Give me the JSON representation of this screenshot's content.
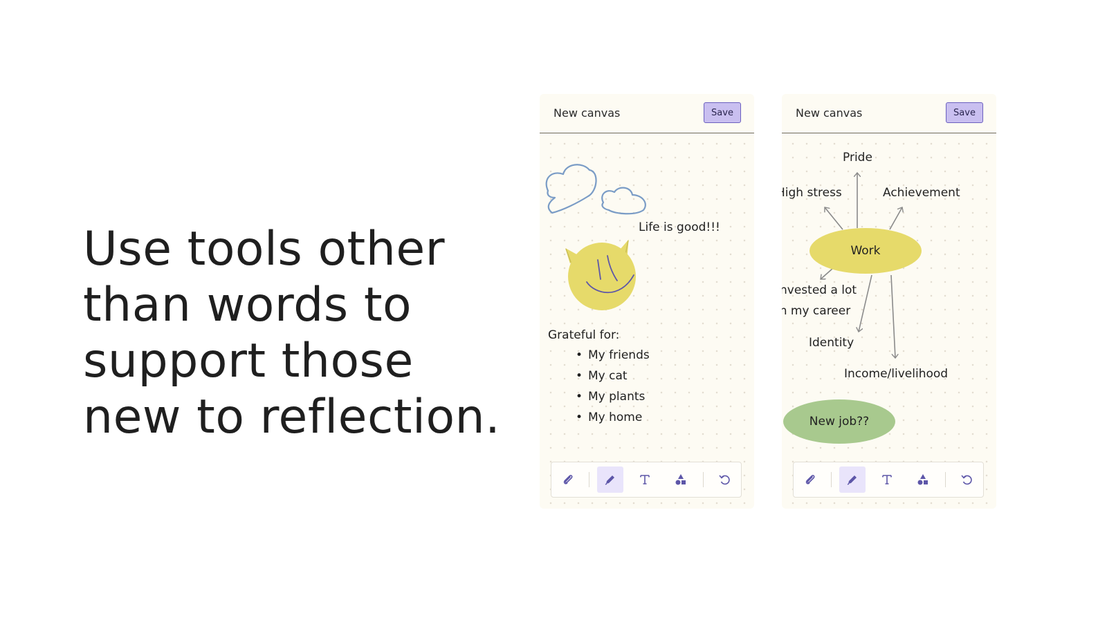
{
  "headline": {
    "lines": [
      "Use tools other",
      "than words to",
      "support those",
      "new to reflection."
    ]
  },
  "screens": {
    "left": {
      "title": "New canvas",
      "save_label": "Save",
      "note": "Life is good!!!",
      "list_heading": "Grateful for:",
      "list_items": [
        "My friends",
        "My cat",
        "My plants",
        "My home"
      ]
    },
    "right": {
      "title": "New canvas",
      "save_label": "Save",
      "center_label": "Work",
      "nodes": {
        "pride": "Pride",
        "high_stress": "High stress",
        "achievement": "Achievement",
        "invested_line1": "Invested a lot",
        "invested_line2": "in my career",
        "identity": "Identity",
        "income": "Income/livelihood"
      },
      "bubble_label": "New job??"
    }
  },
  "toolbar_icons": [
    "paperclip-icon",
    "pen-icon",
    "text-icon",
    "shapes-icon",
    "undo-icon"
  ],
  "colors": {
    "canvas_bg": "#fdfbf3",
    "save_bg": "#c9bff0",
    "accent": "#5d56a8",
    "yellow": "#e6da6a",
    "green": "#a8c98e",
    "cloud_stroke": "#7a9cc6"
  }
}
